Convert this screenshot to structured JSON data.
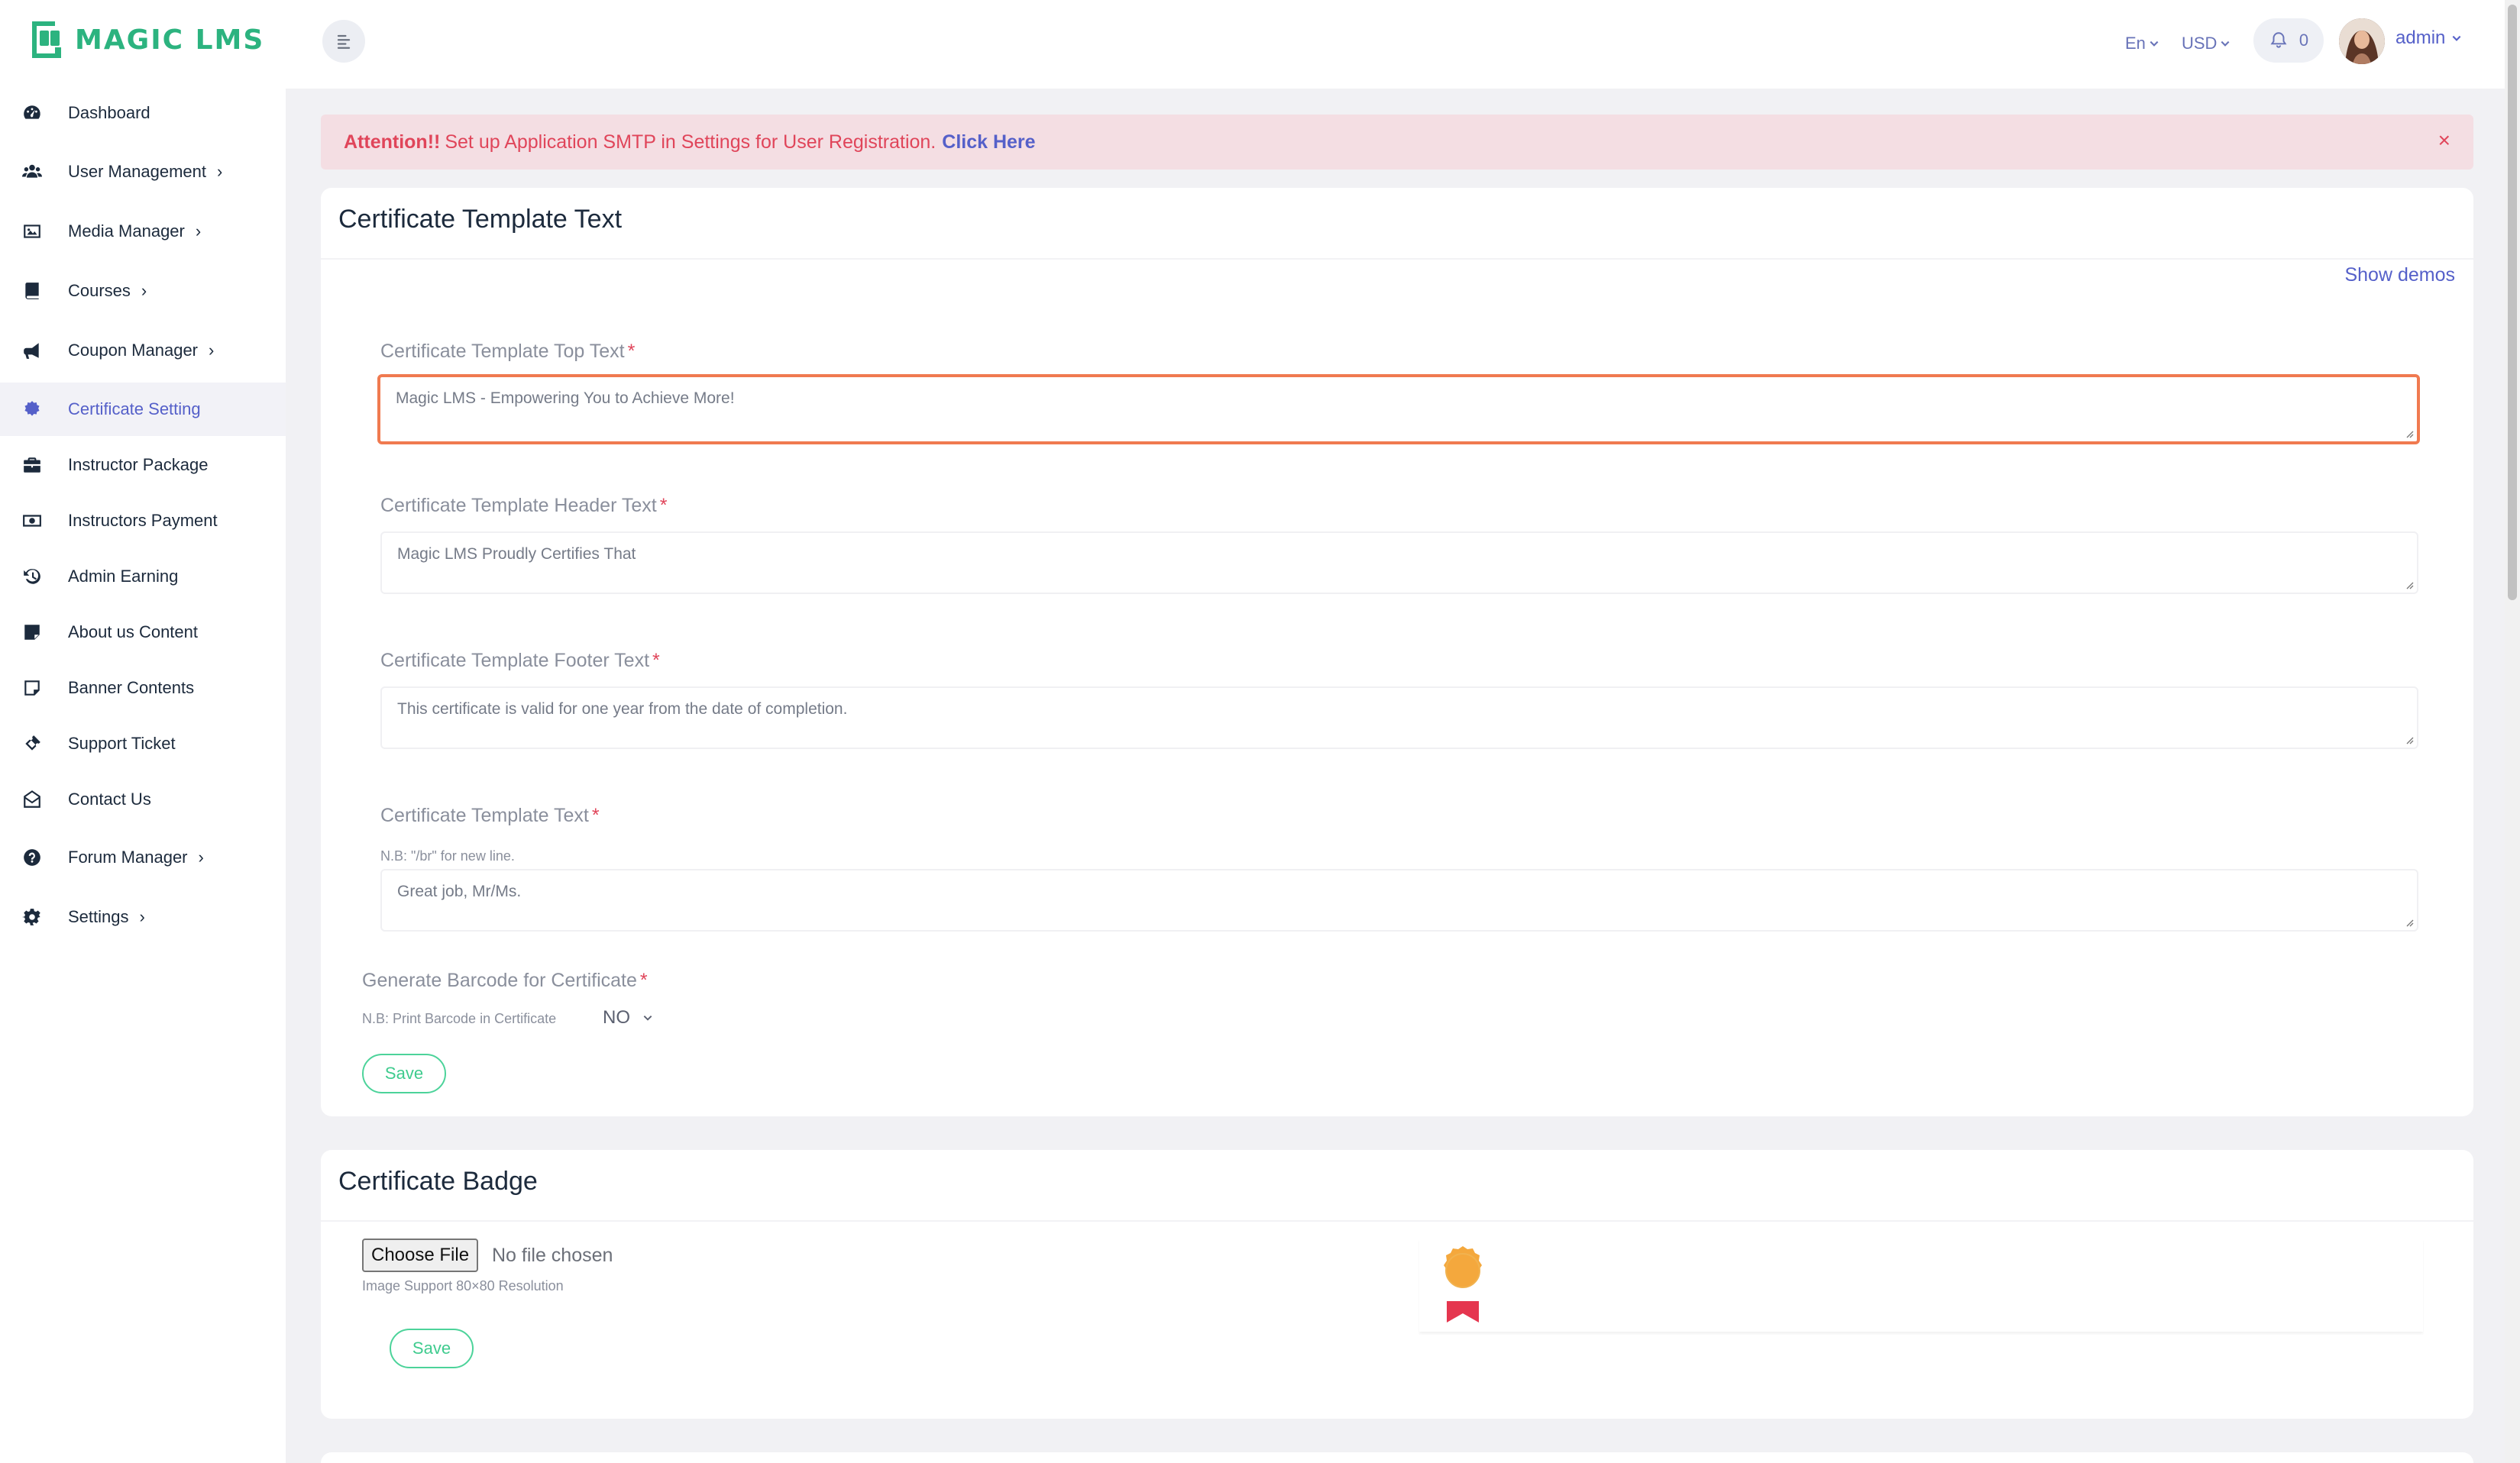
{
  "app": {
    "logo_text": "MAGIC LMS",
    "brand_color": "#2cb37f",
    "accent_color": "#5560c9"
  },
  "sidebar": {
    "items": [
      {
        "label": "Dashboard",
        "icon": "dashboard-icon",
        "has_submenu": false,
        "active": false
      },
      {
        "label": "User Management",
        "icon": "users-icon",
        "has_submenu": true,
        "active": false
      },
      {
        "label": "Media Manager",
        "icon": "image-icon",
        "has_submenu": true,
        "active": false
      },
      {
        "label": "Courses",
        "icon": "book-icon",
        "has_submenu": true,
        "active": false
      },
      {
        "label": "Coupon Manager",
        "icon": "megaphone-icon",
        "has_submenu": true,
        "active": false
      },
      {
        "label": "Certificate Setting",
        "icon": "certificate-icon",
        "has_submenu": false,
        "active": true
      },
      {
        "label": "Instructor Package",
        "icon": "briefcase-icon",
        "has_submenu": false,
        "active": false
      },
      {
        "label": "Instructors Payment",
        "icon": "money-icon",
        "has_submenu": false,
        "active": false
      },
      {
        "label": "Admin Earning",
        "icon": "history-icon",
        "has_submenu": false,
        "active": false
      },
      {
        "label": "About us Content",
        "icon": "sticky-note-icon",
        "has_submenu": false,
        "active": false
      },
      {
        "label": "Banner Contents",
        "icon": "note-icon",
        "has_submenu": false,
        "active": false
      },
      {
        "label": "Support Ticket",
        "icon": "ticket-icon",
        "has_submenu": false,
        "active": false
      },
      {
        "label": "Contact Us",
        "icon": "envelope-open-icon",
        "has_submenu": false,
        "active": false
      },
      {
        "label": "Forum Manager",
        "icon": "question-circle-icon",
        "has_submenu": true,
        "active": false
      },
      {
        "label": "Settings",
        "icon": "gear-icon",
        "has_submenu": true,
        "active": false
      }
    ]
  },
  "topbar": {
    "language": "En",
    "currency": "USD",
    "notification_count": "0",
    "username": "admin"
  },
  "alert": {
    "strong": "Attention!!",
    "message": "Set up Application SMTP in Settings for User Registration.",
    "link": "Click Here",
    "close": "×"
  },
  "certificate_text": {
    "title": "Certificate Template Text",
    "show_demos": "Show demos",
    "top_text": {
      "label": "Certificate Template Top Text",
      "value": "Magic LMS - Empowering You to Achieve More!"
    },
    "header_text": {
      "label": "Certificate Template Header Text",
      "value": "Magic LMS Proudly Certifies That"
    },
    "footer_text": {
      "label": "Certificate Template Footer Text",
      "value": "This certificate is valid for one year from the date of completion."
    },
    "template_text": {
      "label": "Certificate Template Text",
      "hint": "N.B: \"/br\" for new line.",
      "value": "Great job, Mr/Ms."
    },
    "required_mark": "*",
    "barcode": {
      "label": "Generate Barcode for Certificate",
      "hint": "N.B: Print Barcode in Certificate",
      "selected": "NO"
    },
    "save_label": "Save"
  },
  "certificate_badge": {
    "title": "Certificate Badge",
    "choose_file": "Choose File",
    "no_file": "No file chosen",
    "hint": "Image Support 80×80 Resolution",
    "save_label": "Save"
  }
}
